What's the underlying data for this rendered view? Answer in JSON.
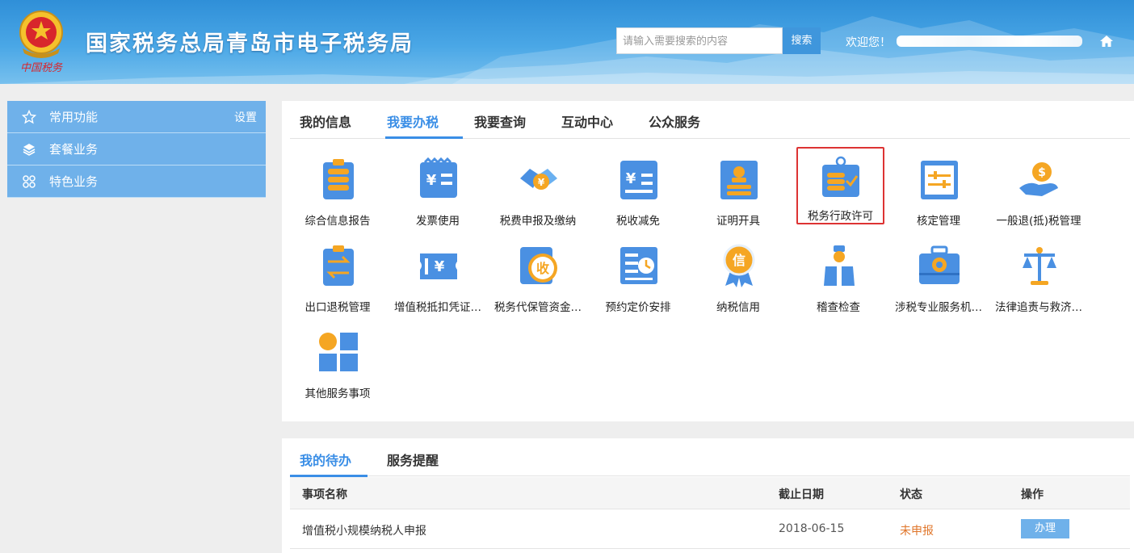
{
  "header": {
    "site_title": "国家税务总局青岛市电子税务局",
    "emblem_caption": "中国税务",
    "search_placeholder": "请输入需要搜索的内容",
    "search_button": "搜索",
    "welcome": "欢迎您！"
  },
  "sidebar": {
    "items": [
      {
        "label": "常用功能",
        "icon": "star-icon",
        "action": "设置"
      },
      {
        "label": "套餐业务",
        "icon": "layers-icon"
      },
      {
        "label": "特色业务",
        "icon": "grid-icon"
      }
    ]
  },
  "main": {
    "tabs": [
      "我的信息",
      "我要办税",
      "我要查询",
      "互动中心",
      "公众服务"
    ],
    "active_tab": "我要办税",
    "tiles": [
      {
        "label": "综合信息报告",
        "icon": "document-stack-icon"
      },
      {
        "label": "发票使用",
        "icon": "invoice-icon"
      },
      {
        "label": "税费申报及缴纳",
        "icon": "handshake-payment-icon"
      },
      {
        "label": "税收减免",
        "icon": "tax-relief-icon"
      },
      {
        "label": "证明开具",
        "icon": "certificate-icon"
      },
      {
        "label": "税务行政许可",
        "icon": "admin-permit-icon"
      },
      {
        "label": "核定管理",
        "icon": "adjust-icon"
      },
      {
        "label": "一般退(抵)税管理",
        "icon": "refund-hand-icon"
      },
      {
        "label": "出口退税管理",
        "icon": "export-refund-icon"
      },
      {
        "label": "增值税抵扣凭证…",
        "icon": "vat-ticket-icon"
      },
      {
        "label": "税务代保管资金…",
        "icon": "custody-funds-icon"
      },
      {
        "label": "预约定价安排",
        "icon": "scheduled-pricing-icon"
      },
      {
        "label": "纳税信用",
        "icon": "credit-medal-icon"
      },
      {
        "label": "稽查检查",
        "icon": "inspector-icon"
      },
      {
        "label": "涉税专业服务机…",
        "icon": "toolbox-icon"
      },
      {
        "label": "法律追责与救济…",
        "icon": "scales-icon"
      },
      {
        "label": "其他服务事项",
        "icon": "other-services-icon"
      }
    ],
    "highlighted_tile": "税务行政许可"
  },
  "todo": {
    "tabs": [
      "我的待办",
      "服务提醒"
    ],
    "active_tab": "我的待办",
    "columns": [
      "事项名称",
      "截止日期",
      "状态",
      "操作"
    ],
    "rows": [
      {
        "name": "增值税小规模纳税人申报",
        "deadline": "2018-06-15",
        "status": "未申报",
        "action": "办理"
      }
    ]
  },
  "colors": {
    "accent": "#3a8ee6",
    "sidebar": "#6fb1ea",
    "status_pending": "#e0762b",
    "icon_blue": "#4a90e2",
    "icon_orange": "#f5a623",
    "highlight_border": "#dd3333"
  }
}
